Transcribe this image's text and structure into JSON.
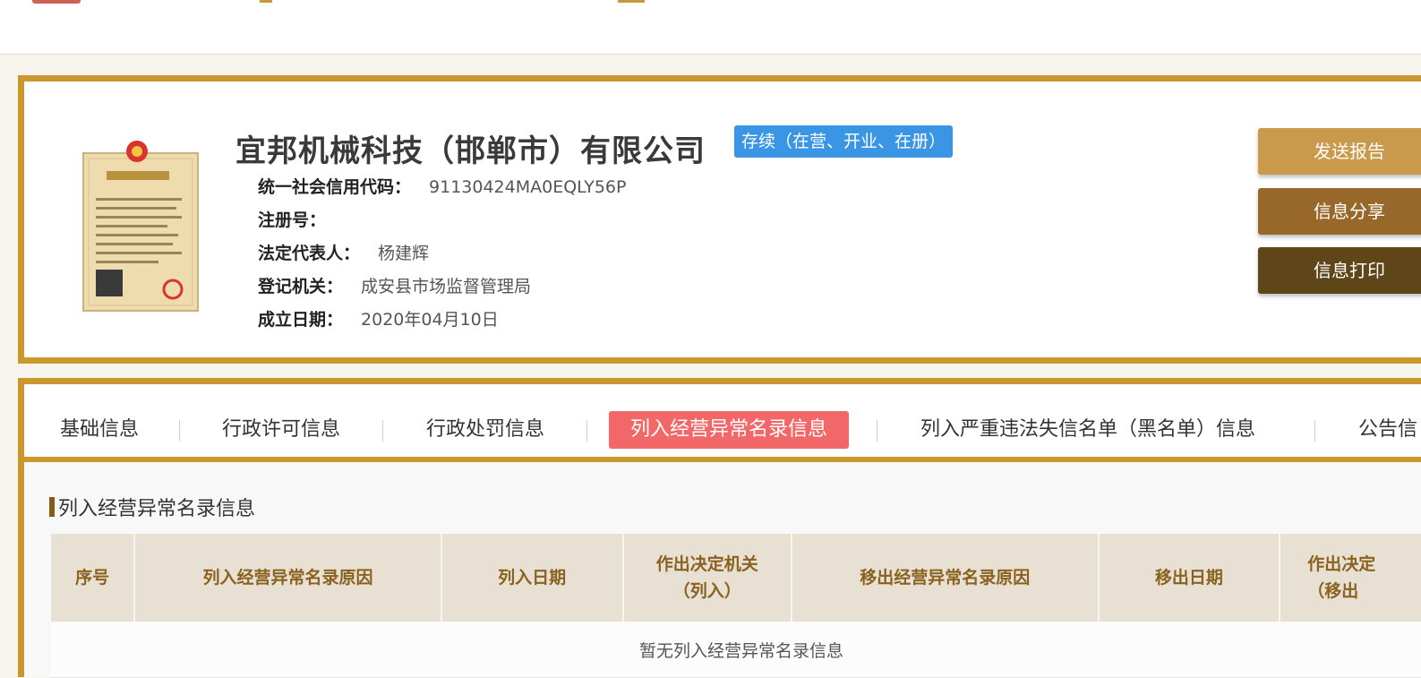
{
  "company": {
    "name": "宜邦机械科技（邯郸市）有限公司",
    "status": "存续（在营、开业、在册）",
    "credit_code_label": "统一社会信用代码：",
    "credit_code": "91130424MA0EQLY56P",
    "reg_no_label": "注册号：",
    "reg_no": "",
    "legal_rep_label": "法定代表人：",
    "legal_rep": "杨建辉",
    "authority_label": "登记机关：",
    "authority": "成安县市场监督管理局",
    "founded_label": "成立日期：",
    "founded": "2020年04月10日",
    "license_image": "business-license-thumbnail"
  },
  "actions": {
    "send_report": "发送报告",
    "share": "信息分享",
    "print": "信息打印"
  },
  "tabs": [
    {
      "label": "基础信息"
    },
    {
      "label": "行政许可信息"
    },
    {
      "label": "行政处罚信息"
    },
    {
      "label": "列入经营异常名录信息",
      "active": true
    },
    {
      "label": "列入严重违法失信名单（黑名单）信息"
    },
    {
      "label": "公告信"
    }
  ],
  "section": {
    "title": "列入经营异常名录信息",
    "columns": [
      "序号",
      "列入经营异常名录原因",
      "列入日期",
      "作出决定机关\n（列入）",
      "移出经营异常名录原因",
      "移出日期",
      "作出决定\n（移出"
    ],
    "empty_text": "暂无列入经营异常名录信息"
  },
  "colors": {
    "accent_gold": "#c9992e",
    "status_blue": "#3b95e5",
    "active_tab": "#f26767",
    "btn_light": "#c99a4c",
    "btn_mid": "#97682a",
    "btn_dark": "#5f4618"
  }
}
